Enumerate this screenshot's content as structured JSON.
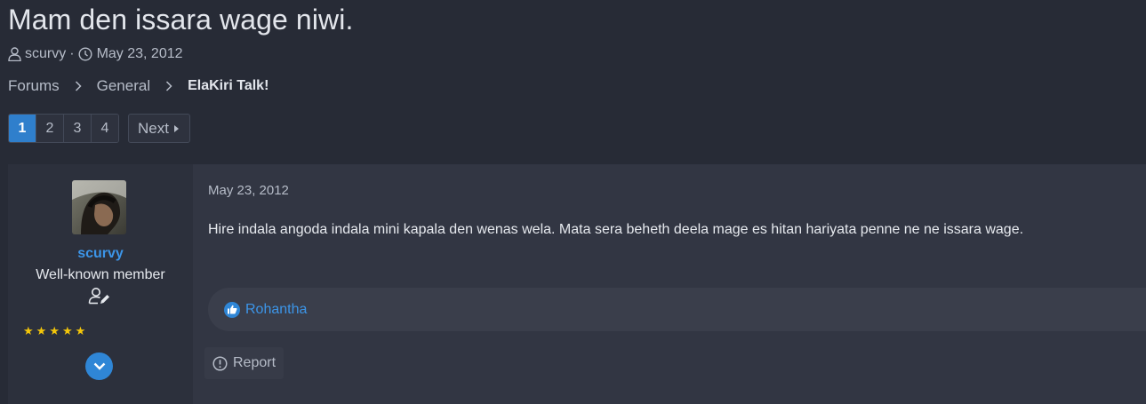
{
  "thread": {
    "title": "Mam den issara wage niwi.",
    "author": "scurvy",
    "separator": "·",
    "date": "May 23, 2012"
  },
  "breadcrumbs": {
    "items": [
      "Forums",
      "General"
    ],
    "current": "ElaKiri Talk!"
  },
  "pagination": {
    "pages": [
      "1",
      "2",
      "3",
      "4"
    ],
    "active_page": "1",
    "next_label": "Next"
  },
  "post": {
    "username": "scurvy",
    "user_title": "Well-known member",
    "star_count": 5,
    "date": "May 23, 2012",
    "body": "Hire indala angoda indala mini kapala den wenas wela. Mata sera beheth deela mage es hitan hariyata penne ne ne issara wage.",
    "reaction_user": "Rohantha",
    "report_label": "Report"
  },
  "colors": {
    "accent": "#2f86d6",
    "username": "#3c95e8",
    "star": "#f4c60a",
    "background": "#272b36"
  },
  "icons": {
    "meta_user": "user-icon",
    "meta_date": "clock-icon",
    "crumb_sep": "chevron-right-icon",
    "badge": "user-edit-icon",
    "expand": "chevron-down-icon",
    "reaction": "like-icon",
    "report": "exclamation-circle-icon"
  }
}
